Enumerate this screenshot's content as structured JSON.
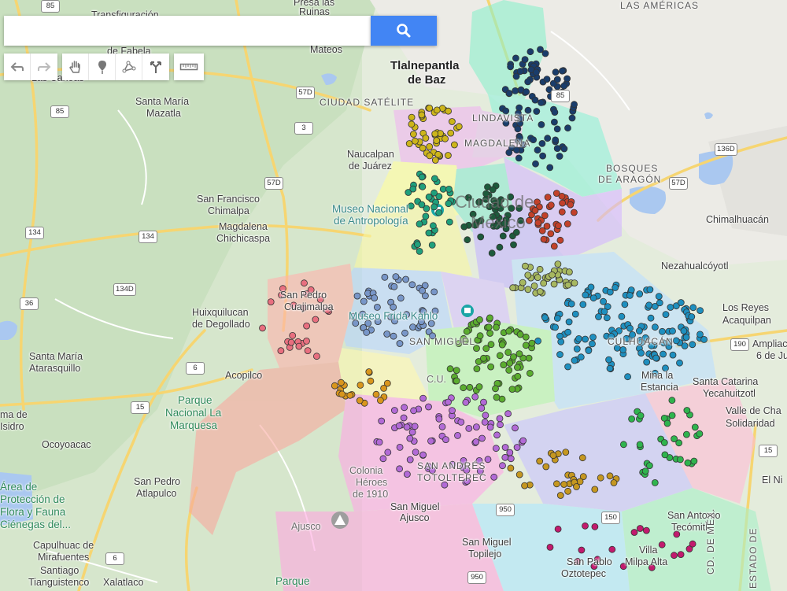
{
  "search": {
    "placeholder": ""
  },
  "toolbar": {
    "history": [
      {
        "name": "undo-button",
        "icon": "undo-icon"
      },
      {
        "name": "redo-button",
        "icon": "redo-icon"
      }
    ],
    "tools": [
      {
        "name": "pan-button",
        "icon": "hand-icon"
      },
      {
        "name": "add-marker-button",
        "icon": "marker-icon"
      },
      {
        "name": "draw-line-button",
        "icon": "polyline-icon"
      },
      {
        "name": "directions-button",
        "icon": "directions-icon"
      }
    ],
    "measure": [
      {
        "name": "measure-button",
        "icon": "ruler-icon"
      }
    ]
  },
  "colors": {
    "search_button": "#4285f4"
  },
  "map": {
    "places": [
      {
        "text": "Transfiguración",
        "style": ""
      },
      {
        "text": "Presa las",
        "style": ""
      },
      {
        "text": "Ruinas",
        "style": ""
      },
      {
        "text": "LAS AMÉRICAS",
        "style": "caps"
      },
      {
        "text": "de Fabela",
        "style": ""
      },
      {
        "text": "Mateos",
        "style": ""
      },
      {
        "text": "Tlalnepantla",
        "style": "major"
      },
      {
        "text": "de Baz",
        "style": "major"
      },
      {
        "text": "Las Canoas",
        "style": ""
      },
      {
        "text": "Santa María",
        "style": ""
      },
      {
        "text": "Mazatla",
        "style": ""
      },
      {
        "text": "CIUDAD SATÉLITE",
        "style": "caps"
      },
      {
        "text": "LINDAVISTA",
        "style": "caps"
      },
      {
        "text": "MAGDALENA",
        "style": "caps"
      },
      {
        "text": "BOSQUES",
        "style": "caps"
      },
      {
        "text": "DE ARAGÓN",
        "style": "caps"
      },
      {
        "text": "Naucalpan",
        "style": ""
      },
      {
        "text": "de Juárez",
        "style": ""
      },
      {
        "text": "Ciudad de",
        "style": "big-faint"
      },
      {
        "text": "México",
        "style": "big-faint"
      },
      {
        "text": "San Francisco",
        "style": ""
      },
      {
        "text": "Chimalpa",
        "style": ""
      },
      {
        "text": "Museo Nacional",
        "style": "poi"
      },
      {
        "text": "de Antropología",
        "style": "poi"
      },
      {
        "text": "Chimalhuacán",
        "style": ""
      },
      {
        "text": "Magdalena",
        "style": ""
      },
      {
        "text": "Chichicaspa",
        "style": ""
      },
      {
        "text": "Nezahualcóyotl",
        "style": ""
      },
      {
        "text": "San Pedro",
        "style": ""
      },
      {
        "text": "Cuajimalpa",
        "style": ""
      },
      {
        "text": "Huixquilucan",
        "style": ""
      },
      {
        "text": "de Degollado",
        "style": ""
      },
      {
        "text": "Museo Frida Kahlo",
        "style": "poi"
      },
      {
        "text": "Los Reyes",
        "style": ""
      },
      {
        "text": "Acaquilpan",
        "style": ""
      },
      {
        "text": "Santa María",
        "style": ""
      },
      {
        "text": "Atarasquillo",
        "style": ""
      },
      {
        "text": "SAN MIGUEL",
        "style": "caps"
      },
      {
        "text": "CULHUACÁN",
        "style": "caps"
      },
      {
        "text": "Ampliación",
        "style": ""
      },
      {
        "text": "6 de Ju",
        "style": ""
      },
      {
        "text": "C.U.",
        "style": "faint"
      },
      {
        "text": "Mina la",
        "style": ""
      },
      {
        "text": "Estancia",
        "style": ""
      },
      {
        "text": "Acopilco",
        "style": ""
      },
      {
        "text": "Santa Catarina",
        "style": ""
      },
      {
        "text": "Yecahuitzotl",
        "style": ""
      },
      {
        "text": "Parque",
        "style": "park"
      },
      {
        "text": "Nacional La",
        "style": "park"
      },
      {
        "text": "Marquesa",
        "style": "park"
      },
      {
        "text": "ma de",
        "style": ""
      },
      {
        "text": "Isidro",
        "style": ""
      },
      {
        "text": "Valle de Cha",
        "style": ""
      },
      {
        "text": "Solidaridad",
        "style": ""
      },
      {
        "text": "Ocoyoacac",
        "style": ""
      },
      {
        "text": "SAN ANDRÉS",
        "style": "caps"
      },
      {
        "text": "TOTOLTEPEC",
        "style": "caps"
      },
      {
        "text": "Colonia",
        "style": "faint"
      },
      {
        "text": "Héroes",
        "style": "faint"
      },
      {
        "text": "de 1910",
        "style": "faint"
      },
      {
        "text": "San Pedro",
        "style": ""
      },
      {
        "text": "Atlapulco",
        "style": ""
      },
      {
        "text": "El Ni",
        "style": ""
      },
      {
        "text": "Área de",
        "style": "park"
      },
      {
        "text": "Protección de",
        "style": "park"
      },
      {
        "text": "Flora y Fauna",
        "style": "park"
      },
      {
        "text": "Ciénegas del...",
        "style": "park"
      },
      {
        "text": "San Miguel",
        "style": ""
      },
      {
        "text": "Ajusco",
        "style": ""
      },
      {
        "text": "Ajusco",
        "style": "faint"
      },
      {
        "text": "San Antonio",
        "style": ""
      },
      {
        "text": "Tecómitl",
        "style": ""
      },
      {
        "text": "San Miguel",
        "style": ""
      },
      {
        "text": "Topilejo",
        "style": ""
      },
      {
        "text": "Capulhuac de",
        "style": ""
      },
      {
        "text": "Mirafuentes",
        "style": ""
      },
      {
        "text": "Villa",
        "style": ""
      },
      {
        "text": "Milpa Alta",
        "style": ""
      },
      {
        "text": "San Pablo",
        "style": ""
      },
      {
        "text": "Oztotepec",
        "style": ""
      },
      {
        "text": "Santiago",
        "style": ""
      },
      {
        "text": "Tianguistenco",
        "style": ""
      },
      {
        "text": "Xalatlaco",
        "style": ""
      },
      {
        "text": "Parque",
        "style": "park"
      },
      {
        "text": "ESTADO DE",
        "style": "caps"
      },
      {
        "text": "CD. DE MÉX.",
        "style": "caps"
      }
    ],
    "shields": [
      "85",
      "57D",
      "3",
      "85",
      "136D",
      "57D",
      "57D",
      "85",
      "134",
      "134",
      "134D",
      "36",
      "6",
      "15",
      "190",
      "950",
      "150",
      "6",
      "950",
      "15"
    ],
    "cluster_colors": [
      "#1a3d6b",
      "#cdb51a",
      "#1fa07c",
      "#1d5a3c",
      "#c2412a",
      "#7896c8",
      "#1e8fbf",
      "#a7b860",
      "#5bad2f",
      "#d9961c",
      "#b26ad6",
      "#2fb44e",
      "#c59720",
      "#e86f7f",
      "#c21a6e"
    ]
  }
}
